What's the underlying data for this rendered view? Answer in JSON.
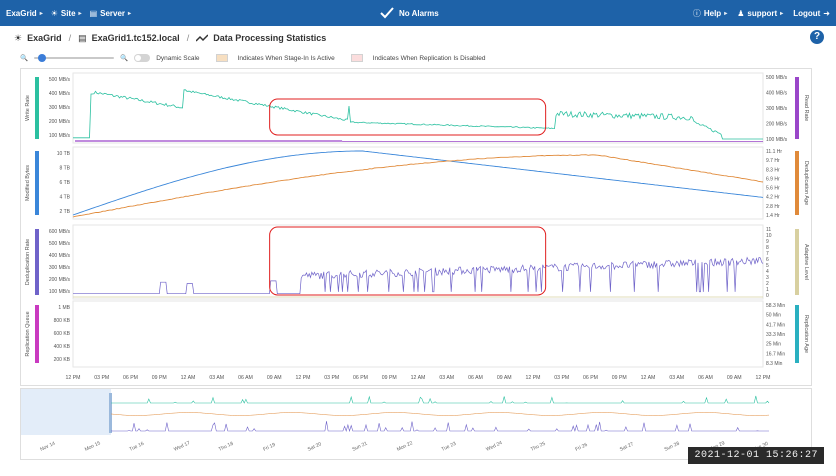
{
  "topbar": {
    "brand": "ExaGrid",
    "site": "Site",
    "server": "Server",
    "alarms": "No Alarms",
    "help": "Help",
    "user": "support",
    "logout": "Logout"
  },
  "breadcrumb": {
    "root": "ExaGrid",
    "server": "ExaGrid1.tc152.local",
    "page": "Data Processing Statistics"
  },
  "toolbar": {
    "dynamic_scale_label": "Dynamic Scale",
    "dynamic_scale_on": false,
    "stage_in_label": "Indicates When Stage-In Is Active",
    "replication_disabled_label": "Indicates When Replication Is Disabled",
    "zoom_level": 0.06,
    "colors": {
      "stage_in": "#f7dfc1",
      "replication_disabled": "#fbdddd"
    }
  },
  "charts": {
    "write_rate": {
      "left_label": "Write Rate",
      "right_label": "Read Rate",
      "ticks_left": [
        "500 MB/s",
        "400 MB/s",
        "300 MB/s",
        "200 MB/s",
        "100 MB/s"
      ],
      "ticks_right": [
        "500 MB/s",
        "400 MB/s",
        "300 MB/s",
        "200 MB/s",
        "100 MB/s"
      ],
      "left_color": "#2bc0a0",
      "right_color": "#9a46c9"
    },
    "modified_bytes": {
      "left_label": "Modified Bytes",
      "right_label": "Deduplication Age",
      "ticks_left": [
        "10 TB",
        "8 TB",
        "6 TB",
        "4 TB",
        "2 TB"
      ],
      "ticks_right": [
        "11.1 Hr",
        "9.7 Hr",
        "8.3 Hr",
        "6.9 Hr",
        "5.6 Hr",
        "4.2 Hr",
        "2.8 Hr",
        "1.4 Hr"
      ],
      "left_color": "#3a86d9",
      "right_color": "#e08a3a"
    },
    "dedup_rate": {
      "left_label": "Deduplication Rate",
      "right_label": "Adaptive Level",
      "ticks_left": [
        "600 MB/s",
        "500 MB/s",
        "400 MB/s",
        "300 MB/s",
        "200 MB/s",
        "100 MB/s"
      ],
      "ticks_right": [
        "11",
        "10",
        "9",
        "8",
        "7",
        "6",
        "5",
        "4",
        "3",
        "2",
        "1",
        "0"
      ],
      "left_color": "#6f63c9",
      "right_color": "#d8d0a0"
    },
    "replication_queue": {
      "left_label": "Replication Queue",
      "right_label": "Replication Age",
      "ticks_left": [
        "1 MB",
        "800 KB",
        "600 KB",
        "400 KB",
        "200 KB"
      ],
      "ticks_right": [
        "58.3 Min",
        "50 Min",
        "41.7 Min",
        "33.3 Min",
        "25 Min",
        "16.7 Min",
        "8.3 Min"
      ],
      "left_color": "#c93ac0",
      "right_color": "#2ab0c0"
    }
  },
  "x_axis": [
    "12 PM",
    "03 PM",
    "06 PM",
    "09 PM",
    "12 AM",
    "03 AM",
    "06 AM",
    "09 AM",
    "12 PM",
    "03 PM",
    "06 PM",
    "09 PM",
    "12 AM",
    "03 AM",
    "06 AM",
    "09 AM",
    "12 PM",
    "03 PM",
    "06 PM",
    "09 PM",
    "12 AM",
    "03 AM",
    "06 AM",
    "09 AM",
    "12 PM"
  ],
  "overview_axis": [
    "Nov 14",
    "Mon 15",
    "Tue 16",
    "Wed 17",
    "Thu 18",
    "Fri 19",
    "Sat 20",
    "Sun 21",
    "Mon 22",
    "Tue 23",
    "Wed 24",
    "Thu 25",
    "Fri 26",
    "Sat 27",
    "Sun 28",
    "Mon 29",
    "Tue 30"
  ],
  "timestamp": "2021-12-01  15:26:27",
  "highlight_color": "#e01f1f"
}
